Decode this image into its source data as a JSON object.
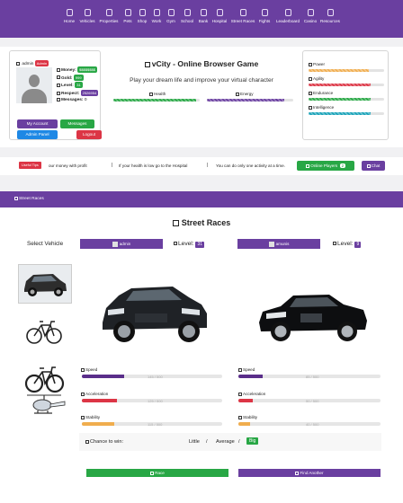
{
  "nav": {
    "items": [
      {
        "label": "Home",
        "icon": "home-icon"
      },
      {
        "label": "Vehicles",
        "icon": "car-icon"
      },
      {
        "label": "Properties",
        "icon": "building-icon"
      },
      {
        "label": "Pets",
        "icon": "paw-icon"
      },
      {
        "label": "Shop",
        "icon": "cart-icon"
      },
      {
        "label": "Work",
        "icon": "briefcase-icon"
      },
      {
        "label": "Gym",
        "icon": "dumbbell-icon"
      },
      {
        "label": "School",
        "icon": "graduation-cap-icon"
      },
      {
        "label": "Bank",
        "icon": "bank-icon"
      },
      {
        "label": "Hospital",
        "icon": "hospital-icon"
      },
      {
        "label": "Street Races",
        "icon": "flag-icon"
      },
      {
        "label": "Fights",
        "icon": "fist-icon"
      },
      {
        "label": "Leaderboard",
        "icon": "trophy-icon"
      },
      {
        "label": "Casino",
        "icon": "diamond-icon"
      },
      {
        "label": "Resources",
        "icon": "dollar-icon"
      }
    ]
  },
  "profile": {
    "username": "admin",
    "role_badge": "Admin",
    "stats": [
      {
        "label": "Money:",
        "value": "$$$$$$$$",
        "icon": "money-icon"
      },
      {
        "label": "Gold:",
        "value": "999",
        "icon": "gold-icon"
      },
      {
        "label": "Level:",
        "value": "31",
        "icon": "level-icon"
      },
      {
        "label": "Respect:",
        "value": "2526954",
        "icon": "respect-icon"
      },
      {
        "label": "Messages:",
        "value": "0",
        "icon": "envelope-icon"
      }
    ],
    "buttons": {
      "my_account": "My Account",
      "messages": "Messages",
      "admin_panel": "Admin Panel",
      "logout": "Logout"
    }
  },
  "header": {
    "title": "vCity - Online Browser Game",
    "subtitle": "Play your dream life and improve your virtual character",
    "health_label": "Health",
    "energy_label": "Energy",
    "health_value": 0.96,
    "energy_value": 0.9
  },
  "attributes": [
    {
      "label": "Power",
      "value": 0.8,
      "color": "#f0ad4e"
    },
    {
      "label": "Agility",
      "value": 0.82,
      "color": "#dc3545"
    },
    {
      "label": "Endurance",
      "value": 0.82,
      "color": "#28a745"
    },
    {
      "label": "Intelligence",
      "value": 0.82,
      "color": "#17a2b8"
    }
  ],
  "ticker": {
    "tag": "Useful Tips",
    "messages": [
      "our money with profit",
      "If your health is low go to the Hospital",
      "You can do only one activity at a time."
    ],
    "online_players_label": "Online Players",
    "online_players_count": "2",
    "chat_label": "Chat"
  },
  "section": {
    "title": "Street Races"
  },
  "race": {
    "title": "Street Races",
    "select_vehicle_label": "Select Vehicle",
    "level_label": "Level:",
    "player": {
      "name": "admin",
      "level": "31"
    },
    "opponent": {
      "name": "amunis",
      "level": "9"
    },
    "vehicles": [
      {
        "name": "suv",
        "icon": "suv-icon"
      },
      {
        "name": "bicycle",
        "icon": "bicycle-icon"
      },
      {
        "name": "mountain bike",
        "icon": "mountain-bike-icon"
      },
      {
        "name": "helicopter",
        "icon": "helicopter-icon"
      }
    ],
    "stat_labels": [
      "Speed",
      "Acceleration",
      "Stability"
    ],
    "player_stats": [
      {
        "label": "Speed",
        "text": "145 / 500",
        "value": 0.3,
        "color": "#5a2e8a"
      },
      {
        "label": "Acceleration",
        "text": "125 / 500",
        "value": 0.25,
        "color": "#dc3545"
      },
      {
        "label": "Stability",
        "text": "115 / 500",
        "value": 0.23,
        "color": "#f0ad4e"
      }
    ],
    "opponent_stats": [
      {
        "label": "Speed",
        "text": "85 / 500",
        "value": 0.17,
        "color": "#5a2e8a"
      },
      {
        "label": "Acceleration",
        "text": "50 / 500",
        "value": 0.1,
        "color": "#dc3545"
      },
      {
        "label": "Stability",
        "text": "40 / 500",
        "value": 0.08,
        "color": "#f0ad4e"
      }
    ],
    "chance": {
      "label": "Chance to win:",
      "options": [
        "Little",
        "/",
        "Average",
        "/",
        "Big"
      ],
      "selected": "Big"
    },
    "race_button": "Race",
    "find_another_button": "Find Another"
  },
  "colors": {
    "brand": "#6a3fa0",
    "success": "#28a745",
    "danger": "#dc3545",
    "info": "#1e88e5"
  }
}
